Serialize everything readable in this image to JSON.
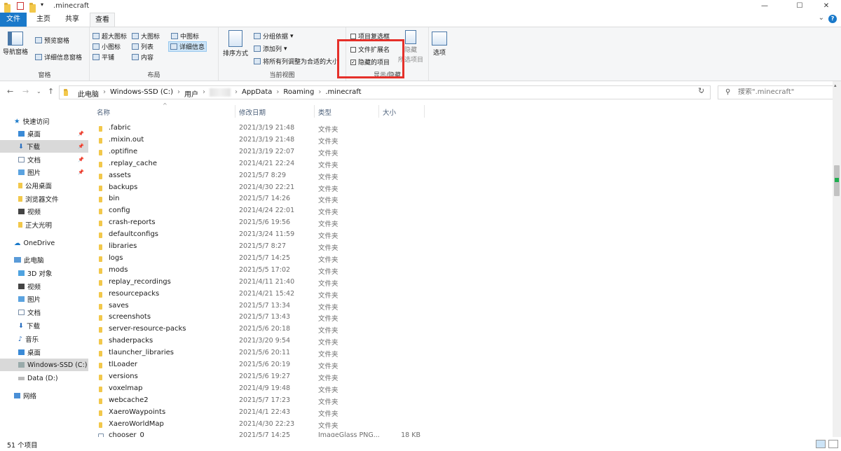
{
  "window": {
    "title": ".minecraft",
    "minimize": "—",
    "maximize": "☐",
    "close": "✕"
  },
  "tabs": [
    "文件",
    "主页",
    "共享",
    "查看"
  ],
  "ribbon": {
    "panes": {
      "label": "窗格",
      "nav_pane": "导航窗格",
      "preview_pane": "预览窗格",
      "details_pane": "详细信息窗格"
    },
    "layout": {
      "label": "布局",
      "items": [
        "超大图标",
        "大图标",
        "中图标",
        "小图标",
        "列表",
        "详细信息",
        "平铺",
        "内容"
      ]
    },
    "current_view": {
      "label": "当前视图",
      "sort_by": "排序方式",
      "group_by": "分组依据",
      "add_column": "添加列",
      "fit_columns": "将所有列调整为合适的大小"
    },
    "show_hide": {
      "label": "显示/隐藏",
      "item_checkboxes": "项目复选框",
      "file_extensions": "文件扩展名",
      "hidden_items": "隐藏的项目",
      "hide_selected": "隐藏",
      "hide_selected_2": "所选项目"
    },
    "options": "选项"
  },
  "address": {
    "crumbs": [
      "此电脑",
      "Windows-SSD (C:)",
      "用户",
      "AppData",
      "Roaming",
      ".minecraft"
    ],
    "search_placeholder": "搜索\".minecraft\""
  },
  "nav": {
    "quick_access": "快速访问",
    "quick_items": [
      "桌面",
      "下载",
      "文档",
      "图片",
      "公用桌面",
      "浏览器文件",
      "视频",
      "正大光明"
    ],
    "onedrive": "OneDrive",
    "this_pc": "此电脑",
    "pc_items": [
      "3D 对象",
      "视频",
      "图片",
      "文档",
      "下载",
      "音乐",
      "桌面",
      "Windows-SSD (C:)",
      "Data (D:)"
    ],
    "network": "网络"
  },
  "columns": {
    "name": "名称",
    "date": "修改日期",
    "type": "类型",
    "size": "大小"
  },
  "files": [
    {
      "name": ".fabric",
      "date": "2021/3/19 21:48",
      "type": "文件夹",
      "size": ""
    },
    {
      "name": ".mixin.out",
      "date": "2021/3/19 21:48",
      "type": "文件夹",
      "size": ""
    },
    {
      "name": ".optifine",
      "date": "2021/3/19 22:07",
      "type": "文件夹",
      "size": ""
    },
    {
      "name": ".replay_cache",
      "date": "2021/4/21 22:24",
      "type": "文件夹",
      "size": ""
    },
    {
      "name": "assets",
      "date": "2021/5/7 8:29",
      "type": "文件夹",
      "size": ""
    },
    {
      "name": "backups",
      "date": "2021/4/30 22:21",
      "type": "文件夹",
      "size": ""
    },
    {
      "name": "bin",
      "date": "2021/5/7 14:26",
      "type": "文件夹",
      "size": ""
    },
    {
      "name": "config",
      "date": "2021/4/24 22:01",
      "type": "文件夹",
      "size": ""
    },
    {
      "name": "crash-reports",
      "date": "2021/5/6 19:56",
      "type": "文件夹",
      "size": ""
    },
    {
      "name": "defaultconfigs",
      "date": "2021/3/24 11:59",
      "type": "文件夹",
      "size": ""
    },
    {
      "name": "libraries",
      "date": "2021/5/7 8:27",
      "type": "文件夹",
      "size": ""
    },
    {
      "name": "logs",
      "date": "2021/5/7 14:25",
      "type": "文件夹",
      "size": ""
    },
    {
      "name": "mods",
      "date": "2021/5/5 17:02",
      "type": "文件夹",
      "size": ""
    },
    {
      "name": "replay_recordings",
      "date": "2021/4/11 21:40",
      "type": "文件夹",
      "size": ""
    },
    {
      "name": "resourcepacks",
      "date": "2021/4/21 15:42",
      "type": "文件夹",
      "size": ""
    },
    {
      "name": "saves",
      "date": "2021/5/7 13:34",
      "type": "文件夹",
      "size": ""
    },
    {
      "name": "screenshots",
      "date": "2021/5/7 13:43",
      "type": "文件夹",
      "size": ""
    },
    {
      "name": "server-resource-packs",
      "date": "2021/5/6 20:18",
      "type": "文件夹",
      "size": ""
    },
    {
      "name": "shaderpacks",
      "date": "2021/3/20 9:54",
      "type": "文件夹",
      "size": ""
    },
    {
      "name": "tlauncher_libraries",
      "date": "2021/5/6 20:11",
      "type": "文件夹",
      "size": ""
    },
    {
      "name": "tlLoader",
      "date": "2021/5/6 20:19",
      "type": "文件夹",
      "size": ""
    },
    {
      "name": "versions",
      "date": "2021/5/6 19:27",
      "type": "文件夹",
      "size": ""
    },
    {
      "name": "voxelmap",
      "date": "2021/4/9 19:48",
      "type": "文件夹",
      "size": ""
    },
    {
      "name": "webcache2",
      "date": "2021/5/7 17:23",
      "type": "文件夹",
      "size": ""
    },
    {
      "name": "XaeroWaypoints",
      "date": "2021/4/1 22:43",
      "type": "文件夹",
      "size": ""
    },
    {
      "name": "XaeroWorldMap",
      "date": "2021/4/30 22:23",
      "type": "文件夹",
      "size": ""
    },
    {
      "name": "chooser_0",
      "date": "2021/5/7 14:25",
      "type": "ImageGlass PNG...",
      "size": "18 KB"
    }
  ],
  "status": {
    "count": "51 个项目"
  },
  "colors": {
    "file_tab": "#1979ca",
    "highlight": "#e5302a",
    "folder": "#f2c84b"
  }
}
